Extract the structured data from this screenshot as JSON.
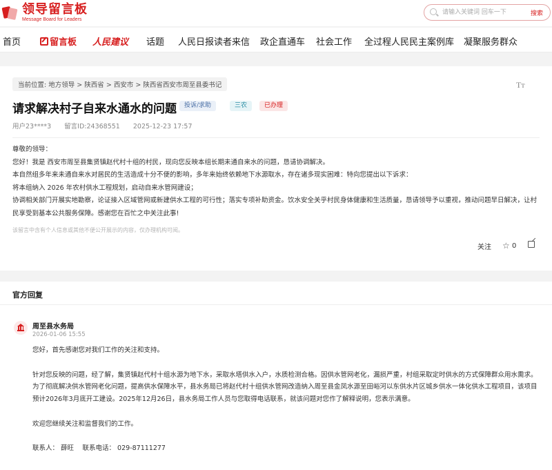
{
  "header": {
    "logo_cn": "领导留言板",
    "logo_en": "Message Board for Leaders",
    "search_placeholder": "请输入关键词 回车一下",
    "search_button": "搜索"
  },
  "nav": {
    "items": [
      "首页",
      "留言板",
      "人民建议",
      "话题",
      "人民日报读者来信",
      "政企直通车",
      "社会工作",
      "全过程人民民主案例库",
      "凝聚服务群众"
    ],
    "active_index": 1,
    "accent_color": "#d71f1f"
  },
  "message": {
    "breadcrumb": [
      "当前位置:",
      "地方领导",
      ">",
      "陕西省",
      ">",
      "西安市",
      ">",
      "陕西省西安市周至县委书记"
    ],
    "font_size_label": "Tт",
    "title": "请求解决村子自来水通水的问题",
    "tags": [
      "投诉/求助",
      "三农",
      "已办理"
    ],
    "user": "用户23****3",
    "message_id": "留言ID:24368551",
    "date": "2025-12-23 17:57",
    "body": [
      "尊敬的领导：",
      "您好！我是 西安市周至县集贤镇赵代村十组的村民，现向您反映本组长期未通自来水的问题，恳请协调解决。",
      "本自然组多年来未通自来水对居民的生活造成十分不便的影响，多年来始终依赖地下水源取水，存在诸多现实困难：特向您提出以下诉求：",
      "将本组纳入 2026 年农村供水工程规划，启动自来水管网建设；",
      "协调相关部门开展实地勘察，论证接入区域管网或新建供水工程的可行性；落实专项补助资金。饮水安全关乎村民身体健康和生活质量，恳请领导予以重视，推动问题早日解决，让村民享受到基本公共服务保障。感谢您在百忙之中关注此事!"
    ],
    "disclaimer": "该留言中含有个人信息或其他不便公开展示的内容，仅办理机构可阅。",
    "follow_label": "关注",
    "like_count": "0"
  },
  "reply": {
    "heading": "官方回复",
    "department": "周至县水务局",
    "time": "2026-01-06 15:55",
    "paragraphs": [
      "您好，首先感谢您对我们工作的关注和支持。",
      "针对您反映的问题，经了解，集贤镇赵代村十组水源为地下水，采取水塔供水入户，水质检测合格。因供水管网老化，漏损严重，村组采取定时供水的方式保障群众用水需求。为了彻底解决供水管网老化问题，提高供水保障水平，县水务局已将赵代村十组供水管网改造纳入周至县金凤水源至田峪河以东供水片区城乡供水一体化供水工程项目，该项目预计2026年3月底开工建设。2025年12月26日，县水务局工作人员与您取得电话联系，就该问题对您作了解释说明，您表示满意。",
      "欢迎您继续关注和监督我们的工作。"
    ],
    "contact": "联系人： 薛旺　 联系电话： 029-87111277"
  }
}
